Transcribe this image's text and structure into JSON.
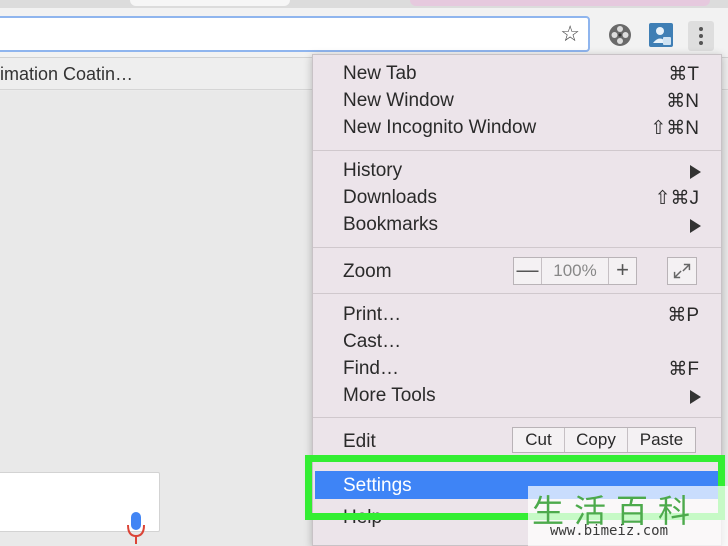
{
  "browser": {
    "bookmark_item": "imation Coatin…",
    "icons": [
      "star-icon",
      "film-reel-icon",
      "profile-icon",
      "menu-dots-icon",
      "microphone-icon"
    ]
  },
  "menu": {
    "new_tab": {
      "label": "New Tab",
      "shortcut": "⌘T"
    },
    "new_window": {
      "label": "New Window",
      "shortcut": "⌘N"
    },
    "new_incognito": {
      "label": "New Incognito Window",
      "shortcut": "⇧⌘N"
    },
    "history": {
      "label": "History"
    },
    "downloads": {
      "label": "Downloads",
      "shortcut": "⇧⌘J"
    },
    "bookmarks": {
      "label": "Bookmarks"
    },
    "zoom": {
      "label": "Zoom",
      "minus": "—",
      "value": "100%",
      "plus": "+"
    },
    "print": {
      "label": "Print…",
      "shortcut": "⌘P"
    },
    "cast": {
      "label": "Cast…"
    },
    "find": {
      "label": "Find…",
      "shortcut": "⌘F"
    },
    "more_tools": {
      "label": "More Tools"
    },
    "edit": {
      "label": "Edit",
      "cut": "Cut",
      "copy": "Copy",
      "paste": "Paste"
    },
    "settings": {
      "label": "Settings"
    },
    "help": {
      "label": "Help"
    }
  },
  "colors": {
    "settings_highlight": "#3e84f6",
    "annotation_box": "#33ee33"
  },
  "watermark": {
    "title": "生活百科",
    "url": "www.bimeiz.com"
  }
}
